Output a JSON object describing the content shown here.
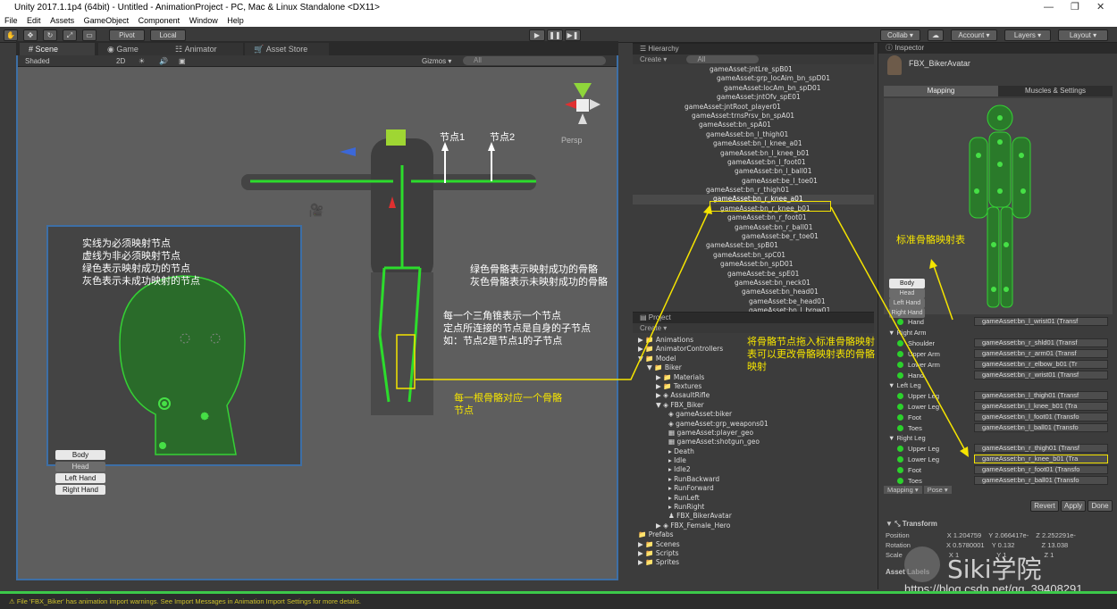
{
  "window": {
    "title": "Unity 2017.1.1p4 (64bit) - Untitled - AnimationProject - PC, Mac & Linux Standalone <DX11>"
  },
  "menu": [
    "File",
    "Edit",
    "Assets",
    "GameObject",
    "Component",
    "Window",
    "Help"
  ],
  "toolbar": {
    "pivot": "Pivot",
    "local": "Local",
    "collab": "Collab ▾",
    "account": "Account ▾",
    "layers": "Layers ▾",
    "layout": "Layout ▾"
  },
  "scene": {
    "tabs": [
      "Scene",
      "Game",
      "Animator",
      "Asset Store"
    ],
    "shading": "Shaded",
    "mode2d": "2D",
    "gizmos": "Gizmos ▾",
    "search_placeholder": "All",
    "persp": "Persp",
    "node1": "节点1",
    "node2": "节点2",
    "legend": [
      "实线为必须映射节点",
      "虚线为非必须映射节点",
      "绿色表示映射成功的节点",
      "灰色表示未成功映射的节点"
    ],
    "note_bones": [
      "绿色骨骼表示映射成功的骨骼",
      "灰色骨骼表示未映射成功的骨骼"
    ],
    "note_triangle": [
      "每一个三角锥表示一个节点",
      "定点所连接的节点是自身的子节点",
      "如：节点2是节点1的子节点"
    ],
    "note_each_bone": [
      "每一根骨骼对应一个骨骼",
      "节点"
    ],
    "body_buttons": [
      "Body",
      "Head",
      "Left Hand",
      "Right Hand"
    ]
  },
  "hierarchy": {
    "title": "Hierarchy",
    "create": "Create ▾",
    "search_placeholder": "All",
    "items": [
      "gameAsset:jntLre_spB01",
      "gameAsset:grp_locAim_bn_spD01",
      "gameAsset:locAm_bn_spD01",
      "gameAsset:jntOfv_spE01",
      "gameAsset:jntRoot_player01",
      "gameAsset:trnsPrsv_bn_spA01",
      "gameAsset:bn_spA01",
      "gameAsset:bn_l_thigh01",
      "gameAsset:bn_l_knee_a01",
      "gameAsset:bn_l_knee_b01",
      "gameAsset:bn_l_foot01",
      "gameAsset:bn_l_ball01",
      "gameAsset:be_l_toe01",
      "gameAsset:bn_r_thigh01",
      "gameAsset:bn_r_knee_a01",
      "gameAsset:bn_r_knee_b01",
      "gameAsset:bn_r_foot01",
      "gameAsset:bn_r_ball01",
      "gameAsset:be_r_toe01",
      "gameAsset:bn_spB01",
      "gameAsset:bn_spC01",
      "gameAsset:bn_spD01",
      "gameAsset:be_spE01",
      "gameAsset:bn_neck01",
      "gameAsset:bn_head01",
      "gameAsset:be_head01",
      "gameAsset:bn_l_brow01"
    ]
  },
  "project": {
    "title": "Project",
    "create": "Create ▾",
    "items": [
      "Animations",
      "AnimatorControllers",
      "Model",
      "Biker",
      "Materials",
      "Textures",
      "AssaultRifle",
      "FBX_Biker",
      "gameAsset:biker",
      "gameAsset:grp_weapons01",
      "gameAsset:player_geo",
      "gameAsset:shotgun_geo",
      "Death",
      "Idle",
      "Idle2",
      "RunBackward",
      "RunForward",
      "RunLeft",
      "RunRight",
      "FBX_BikerAvatar",
      "FBX_Female_Hero",
      "Prefabs",
      "Scenes",
      "Scripts",
      "Sprites"
    ],
    "note_drag": [
      "将骨骼节点拖入标准骨骼映射",
      "表可以更改骨骼映射表的骨骼",
      "映射"
    ]
  },
  "inspector": {
    "title": "Inspector",
    "object": "FBX_BikerAvatar",
    "tabs": [
      "Mapping",
      "Muscles & Settings"
    ],
    "note_std": "标准骨骼映射表",
    "body_buttons": [
      "Body",
      "Head",
      "Left Hand",
      "Right Hand"
    ],
    "hand_row": {
      "label": "Hand",
      "value": "gameAsset:bn_l_wrist01 (Transf"
    },
    "right_arm": {
      "title": "Right Arm",
      "rows": [
        {
          "label": "Shoulder",
          "value": "gameAsset:bn_r_shld01 (Transf"
        },
        {
          "label": "Upper Arm",
          "value": "gameAsset:bn_r_arm01 (Transf"
        },
        {
          "label": "Lower Arm",
          "value": "gameAsset:bn_r_elbow_b01 (Tr"
        },
        {
          "label": "Hand",
          "value": "gameAsset:bn_r_wrist01 (Transf"
        }
      ]
    },
    "left_leg": {
      "title": "Left Leg",
      "rows": [
        {
          "label": "Upper Leg",
          "value": "gameAsset:bn_l_thigh01 (Transf"
        },
        {
          "label": "Lower Leg",
          "value": "gameAsset:bn_l_knee_b01 (Tra"
        },
        {
          "label": "Foot",
          "value": "gameAsset:bn_l_foot01 (Transfo"
        },
        {
          "label": "Toes",
          "value": "gameAsset:bn_l_ball01 (Transfo"
        }
      ]
    },
    "right_leg": {
      "title": "Right Leg",
      "rows": [
        {
          "label": "Upper Leg",
          "value": "gameAsset:bn_r_thigh01 (Transf"
        },
        {
          "label": "Lower Leg",
          "value": "gameAsset:bn_r_knee_b01 (Tra"
        },
        {
          "label": "Foot",
          "value": "gameAsset:bn_r_foot01 (Transfo"
        },
        {
          "label": "Toes",
          "value": "gameAsset:bn_r_ball01 (Transfo"
        }
      ]
    },
    "mapping_btn": "Mapping ▾",
    "pose_btn": "Pose ▾",
    "revert": "Revert",
    "apply": "Apply",
    "done": "Done",
    "transform": {
      "title": "Transform",
      "position": [
        "1.204759",
        "2.066417e-",
        "2.252291e-"
      ],
      "rotation": [
        "0.5780001",
        "0.132",
        "13.038"
      ],
      "scale": [
        "1",
        "1",
        "1"
      ]
    },
    "asset_labels": "Asset Labels"
  },
  "status": "File 'FBX_Biker' has animation import warnings. See Import Messages in Animation Import Settings for more details.",
  "watermark": {
    "brand": "Siki学院",
    "url": "https://blog.csdn.net/qq_39408291"
  }
}
